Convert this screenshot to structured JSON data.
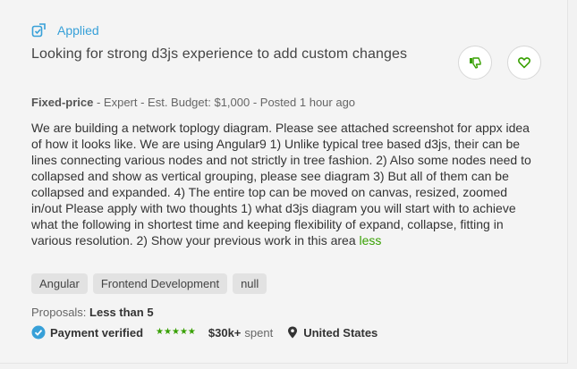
{
  "status": {
    "label": "Applied",
    "icon": "applied-icon",
    "color": "#37a0d8"
  },
  "job": {
    "title": "Looking for strong d3js experience to add custom changes",
    "payment_type": "Fixed-price",
    "meta_rest": " - Expert - Est. Budget: $1,000 - Posted 1 hour ago",
    "description": "We are building a network toplogy diagram. Please see attached screenshot for appx idea of how it looks like. We are using Angular9 1) Unlike typical tree based d3js, their can be lines connecting various nodes and not strictly in tree fashion. 2) Also some nodes need to collapsed and show as vertical grouping, please see diagram 3) But all of them can be collapsed and expanded. 4) The entire top can be moved on canvas, resized, zoomed in/out Please apply with two thoughts 1) what d3js diagram you will start with to achieve what the following in shortest time and keeping flexibility of expand, collapse, fitting in various resolution. 2) Show your previous work in this area",
    "less_link": "less",
    "tags": [
      "Angular",
      "Frontend Development",
      "null"
    ],
    "proposals_label": "Proposals:",
    "proposals_value": "Less than 5"
  },
  "actions": {
    "dislike_icon": "thumbs-down-icon",
    "save_icon": "heart-icon"
  },
  "client": {
    "payment_verified": "Payment verified",
    "rating_stars": 5,
    "spent_value": "$30k+",
    "spent_label": "spent",
    "location": "United States"
  },
  "colors": {
    "accent_green": "#37a000",
    "accent_blue": "#37a0d8"
  }
}
